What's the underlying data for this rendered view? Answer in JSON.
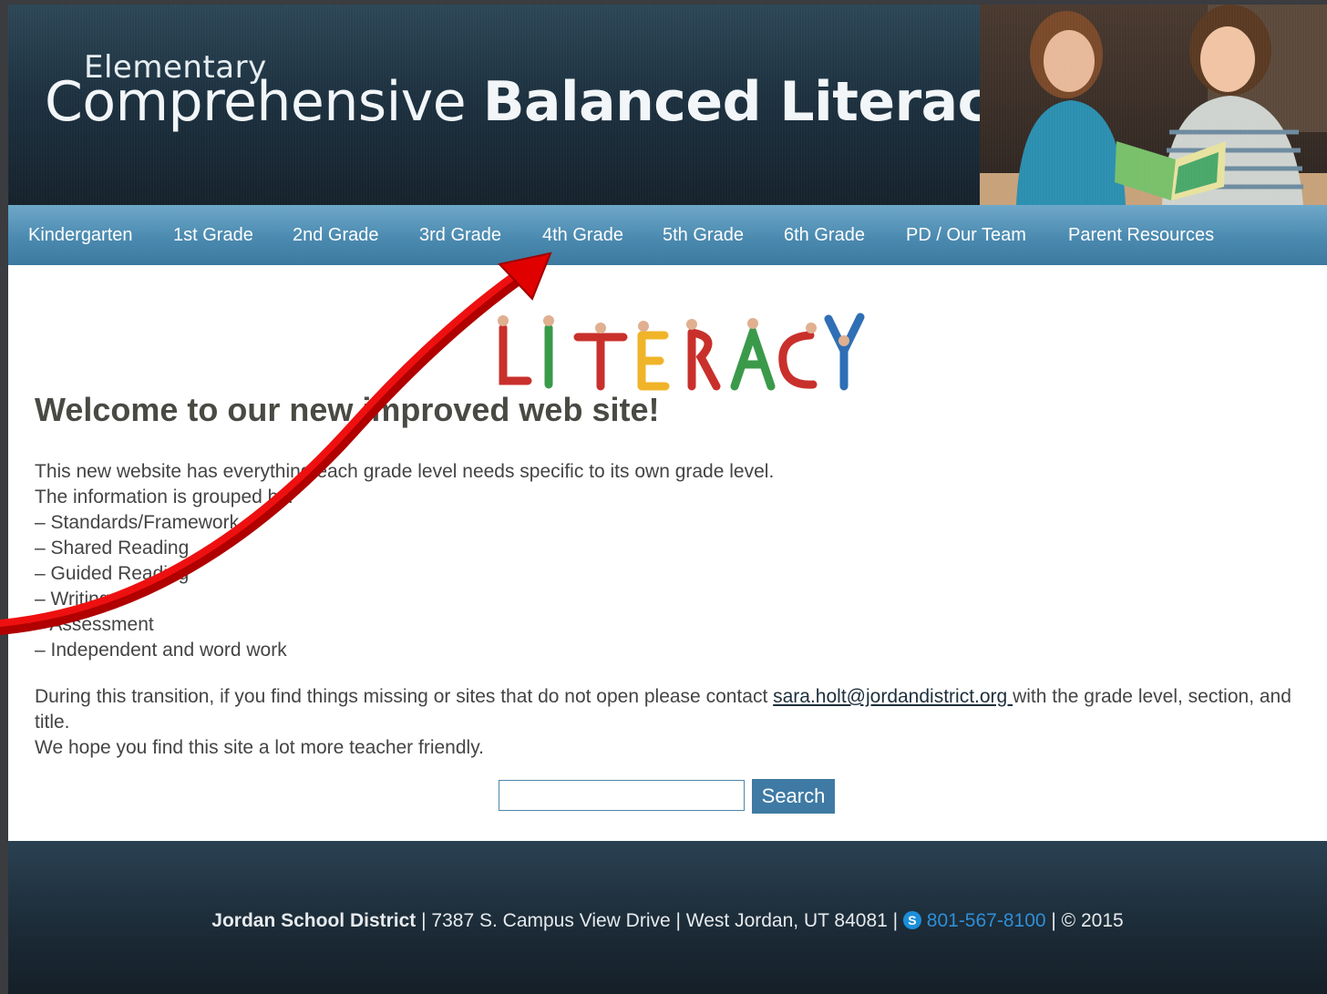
{
  "header": {
    "subtitle": "Elementary",
    "title_light": "Comprehensive",
    "title_bold": "Balanced Literacy"
  },
  "nav": [
    {
      "label": "Kindergarten"
    },
    {
      "label": "1st Grade"
    },
    {
      "label": "2nd Grade"
    },
    {
      "label": "3rd Grade"
    },
    {
      "label": "4th Grade"
    },
    {
      "label": "5th Grade"
    },
    {
      "label": "6th Grade"
    },
    {
      "label": "PD / Our Team"
    },
    {
      "label": "Parent Resources"
    }
  ],
  "logo": {
    "text": "LITERACY",
    "colors": [
      "#c9302c",
      "#3a9a4a",
      "#2f6fb5",
      "#f0b429",
      "#7a4fa0"
    ]
  },
  "main": {
    "heading": "Welcome to our new improved web site!",
    "intro_lines": [
      "This new website has everything each grade level needs specific to its own grade level.",
      "The information is grouped by:"
    ],
    "groups": [
      "– Standards/Framework",
      "– Shared Reading",
      "– Guided Reading",
      "– Writing",
      "– Assessment",
      "– Independent and word work"
    ],
    "contact_before": "During this transition, if you find things missing or sites that do not open please contact ",
    "contact_email": "sara.holt@jordandistrict.org ",
    "contact_after": "with the grade level, section, and title.",
    "closing": "We hope you find this site a lot more teacher friendly."
  },
  "search": {
    "value": "",
    "button_label": "Search"
  },
  "footer": {
    "org": "Jordan School District",
    "address": " | 7387 S. Campus View Drive | West Jordan, UT 84081 | ",
    "skype_glyph": "S",
    "phone": "801-567-8100",
    "copyright": " | © 2015"
  },
  "annotation": {
    "color": "#e00000",
    "target": "4th Grade"
  }
}
